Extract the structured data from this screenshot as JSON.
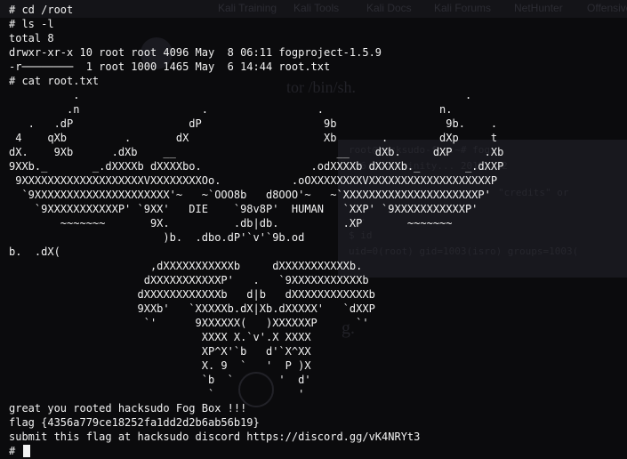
{
  "terminal": {
    "lines": [
      "# cd /root",
      "# ls -l",
      "total 8",
      "drwxr-xr-x 10 root root 4096 May  8 06:11 fogproject-1.5.9",
      "-r────────  1 root 1000 1465 May  6 14:44 root.txt",
      "# cat root.txt",
      "          .                                                            .",
      "         .n                   .                 .                  n.",
      "   .   .dP                  dP                   9b                 9b.    .",
      " 4    qXb         .       dX                     Xb       .        dXp     t",
      "dX.    9Xb      .dXb    __                         __    dXb.     dXP     .Xb",
      "9XXb._       _.dXXXXb dXXXXbo.                 .odXXXXb dXXXXb._       _.dXXP",
      " 9XXXXXXXXXXXXXXXXXXXVXXXXXXXXOo.           .oOXXXXXXXXVXXXXXXXXXXXXXXXXXXXP",
      "  `9XXXXXXXXXXXXXXXXXXXXX'~   ~`OOO8b   d8OOO'~   ~`XXXXXXXXXXXXXXXXXXXXXP'",
      "    `9XXXXXXXXXXXP' `9XX'   DIE    `98v8P'  HUMAN   `XXP' `9XXXXXXXXXXXP'",
      "        ~~~~~~~       9X.          .db|db.          .XP       ~~~~~~~",
      "                        )b.  .dbo.dP'`v'`9b.od",
      "b.  .dX(",
      "                      ,dXXXXXXXXXXXb     dXXXXXXXXXXXb.",
      "                     dXXXXXXXXXXXP'   .   `9XXXXXXXXXXXb",
      "                    dXXXXXXXXXXXXb   d|b   dXXXXXXXXXXXXb",
      "                    9XXb'   `XXXXXb.dX|Xb.dXXXXX'   `dXXP",
      "                     `'      9XXXXXX(   )XXXXXXP      `'",
      "                              XXXX X.`v'.X XXXX",
      "                              XP^X'`b   d'`X^XX",
      "                              X. 9  `   '  P )X",
      "                              `b  `       '  d'",
      "                               `             '",
      "great you rooted hacksudo Fog Box !!!",
      "flag {4356a779ce18252fa1dd2d2b6ab56b19}",
      "submit this flag at hacksudo discord https://discord.gg/vK4NRYt3"
    ],
    "prompt": "# "
  },
  "background_page": {
    "tabs": [
      "Kali Training",
      "Kali Tools",
      "Kali Docs",
      "Kali Forums",
      "NetHunter",
      "Offensive"
    ],
    "heading": "tor /bin/sh.",
    "code_lines": [
      "root@hacksudo-fog:~# fog",
      "2.6.32 (trinity... 2019, 22",
      "\"credits\" or",
      "...",
      "$ id",
      "uid=0(root) gid=1003(isro) groups=1003("
    ],
    "letter": "g."
  },
  "colors": {
    "background": "#0b0b0d",
    "foreground": "#f2f2f2"
  }
}
